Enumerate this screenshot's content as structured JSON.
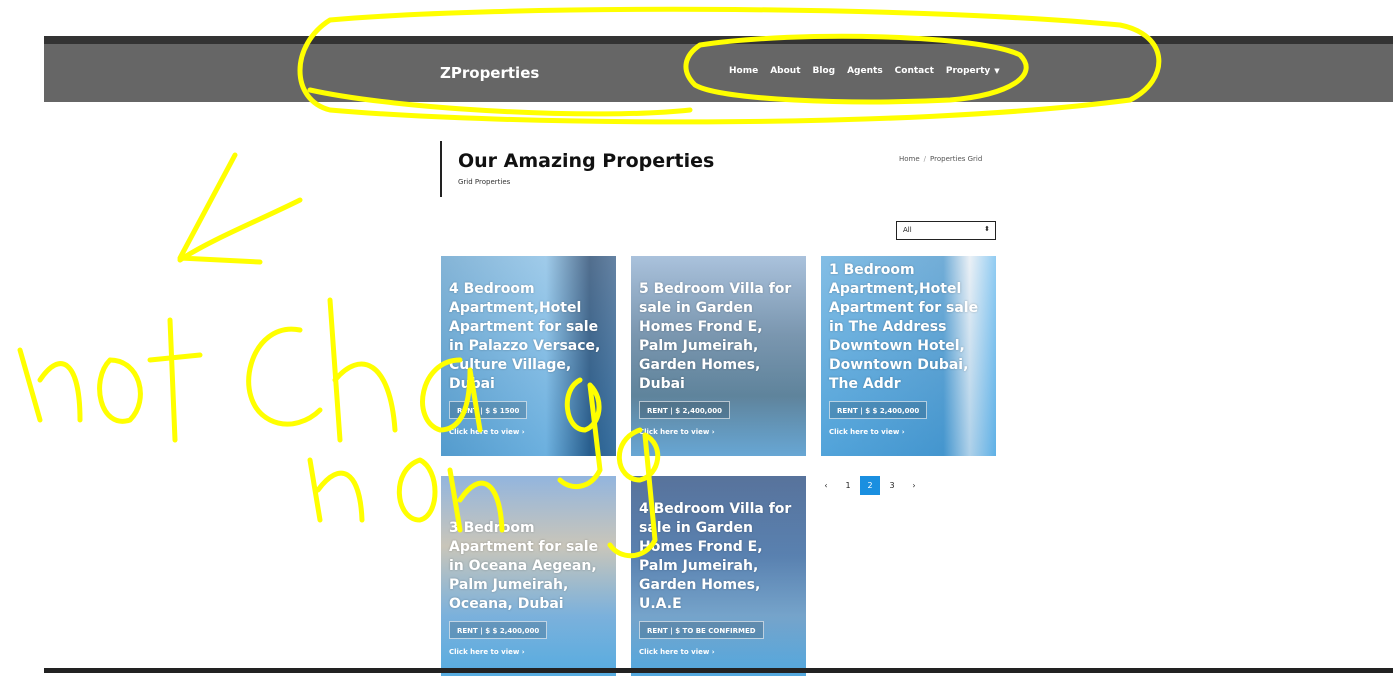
{
  "header": {
    "brand": "ZProperties",
    "nav": [
      {
        "label": "Home"
      },
      {
        "label": "About"
      },
      {
        "label": "Blog"
      },
      {
        "label": "Agents"
      },
      {
        "label": "Contact"
      },
      {
        "label": "Property"
      }
    ]
  },
  "page": {
    "title": "Our Amazing Properties",
    "subtitle": "Grid Properties",
    "breadcrumb": [
      "Home",
      "Properties Grid"
    ]
  },
  "filter": {
    "selected": "All"
  },
  "cards": [
    {
      "title": "4 Bedroom Apartment,Hotel Apartment for sale in Palazzo Versace, Culture Village, Dubai",
      "price": "RENT | $ $ 1500",
      "cta": "Click here to view"
    },
    {
      "title": "5 Bedroom Villa for sale in Garden Homes Frond E, Palm Jumeirah, Garden Homes, Dubai",
      "price": "RENT | $ 2,400,000",
      "cta": "Click here to view"
    },
    {
      "title": "1 Bedroom Apartment,Hotel Apartment for sale in The Address Downtown Hotel, Downtown Dubai, The Addr",
      "price": "RENT | $ $ 2,400,000",
      "cta": "Click here to view"
    },
    {
      "title": "3 Bedroom Apartment for sale in Oceana Aegean, Palm Jumeirah, Oceana, Dubai",
      "price": "RENT | $ $ 2,400,000",
      "cta": "Click here to view"
    },
    {
      "title": "4 Bedroom Villa for sale in Garden Homes Frond E, Palm Jumeirah, Garden Homes, U.A.E",
      "price": "RENT | $ TO BE CONFIRMED",
      "cta": "Click here to view"
    }
  ],
  "pagination": {
    "prev": "‹",
    "pages": [
      "1",
      "2",
      "3"
    ],
    "active": "2",
    "next": "›"
  },
  "colors": {
    "navbar": "#666666",
    "accent": "#1a8fe0",
    "annotation": "#ffff00"
  }
}
